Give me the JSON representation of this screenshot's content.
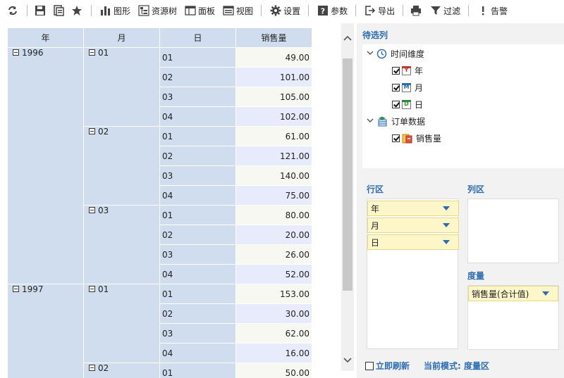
{
  "toolbar": {
    "items": [
      {
        "icon": "refresh-icon",
        "label": ""
      },
      {
        "icon": "save-icon",
        "label": ""
      },
      {
        "icon": "save-as-icon",
        "label": ""
      },
      {
        "icon": "favorite-icon",
        "label": ""
      },
      {
        "icon": "chart-icon",
        "label": "图形"
      },
      {
        "icon": "resource-tree-icon",
        "label": "资源树"
      },
      {
        "icon": "panel-icon",
        "label": "面板"
      },
      {
        "icon": "view-icon",
        "label": "视图"
      },
      {
        "icon": "gear-icon",
        "label": "设置"
      },
      {
        "icon": "help-icon",
        "label": "参数"
      },
      {
        "icon": "export-icon",
        "label": "导出"
      },
      {
        "icon": "print-icon",
        "label": "打印"
      },
      {
        "icon": "filter-icon",
        "label": "过滤"
      },
      {
        "icon": "alert-icon",
        "label": "告警"
      }
    ]
  },
  "grid": {
    "headers": {
      "year": "年",
      "month": "月",
      "day": "日",
      "sales": "销售量"
    },
    "rows": [
      {
        "year": "1996",
        "month": "01",
        "day": "01",
        "value": "49.00"
      },
      {
        "year": "",
        "month": "",
        "day": "02",
        "value": "101.00"
      },
      {
        "year": "",
        "month": "",
        "day": "03",
        "value": "105.00"
      },
      {
        "year": "",
        "month": "",
        "day": "04",
        "value": "102.00"
      },
      {
        "year": "",
        "month": "02",
        "day": "01",
        "value": "61.00"
      },
      {
        "year": "",
        "month": "",
        "day": "02",
        "value": "121.00"
      },
      {
        "year": "",
        "month": "",
        "day": "03",
        "value": "140.00"
      },
      {
        "year": "",
        "month": "",
        "day": "04",
        "value": "75.00"
      },
      {
        "year": "",
        "month": "03",
        "day": "01",
        "value": "80.00"
      },
      {
        "year": "",
        "month": "",
        "day": "02",
        "value": "20.00"
      },
      {
        "year": "",
        "month": "",
        "day": "03",
        "value": "26.00"
      },
      {
        "year": "",
        "month": "",
        "day": "04",
        "value": "52.00"
      },
      {
        "year": "1997",
        "month": "01",
        "day": "01",
        "value": "153.00"
      },
      {
        "year": "",
        "month": "",
        "day": "02",
        "value": "30.00"
      },
      {
        "year": "",
        "month": "",
        "day": "03",
        "value": "62.00"
      },
      {
        "year": "",
        "month": "",
        "day": "04",
        "value": "16.00"
      },
      {
        "year": "",
        "month": "02",
        "day": "01",
        "value": "50.00"
      }
    ]
  },
  "candidates": {
    "title": "待选列",
    "time_group": "时间维度",
    "year": "年",
    "month": "月",
    "day": "日",
    "order_group": "订单数据",
    "sales": "销售量"
  },
  "row_zone": {
    "title": "行区",
    "items": [
      "年",
      "月",
      "日"
    ]
  },
  "col_zone": {
    "title": "列区"
  },
  "measure_zone": {
    "title": "度量",
    "items": [
      "销售量(合计值)"
    ]
  },
  "footer": {
    "refresh_label": "立即刷新",
    "mode_label": "当前模式: 度量区"
  }
}
